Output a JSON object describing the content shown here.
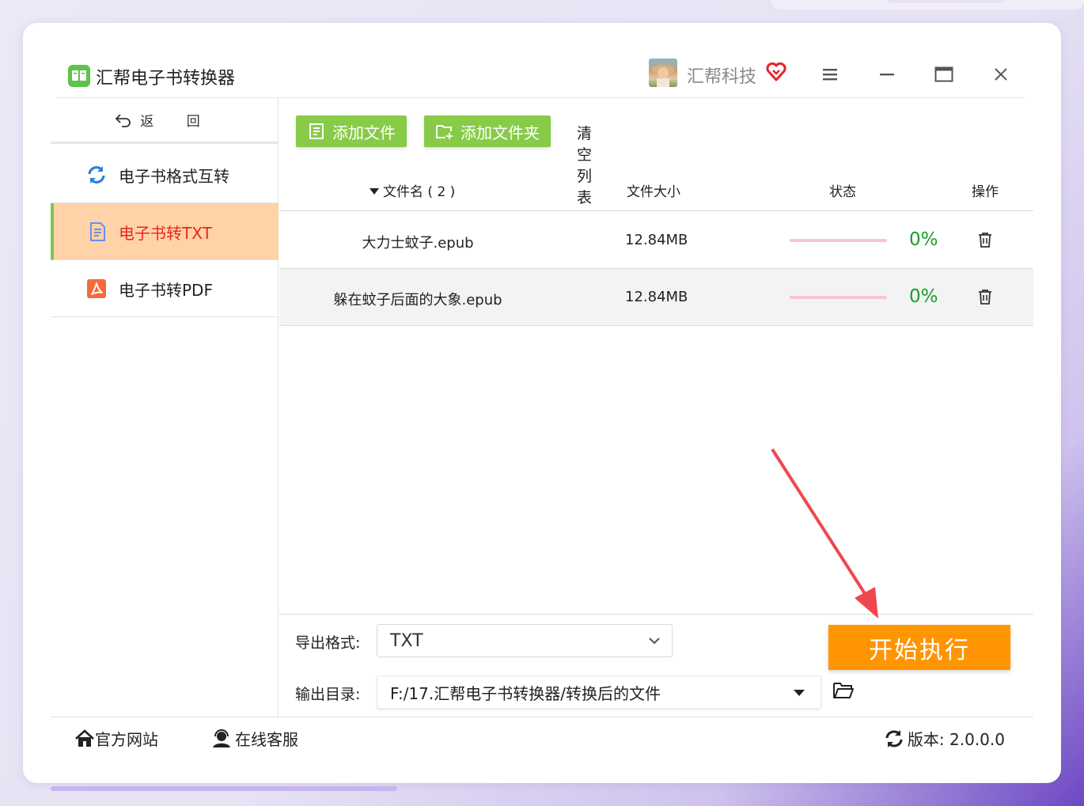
{
  "titlebar": {
    "app_title": "汇帮电子书转换器",
    "username": "汇帮科技",
    "icons": [
      "book-icon",
      "vip-heart-icon",
      "menu-icon",
      "minimize-icon",
      "maximize-icon",
      "close-icon"
    ]
  },
  "sidebar": {
    "back_label": "返 回",
    "items": [
      {
        "label": "电子书格式互转",
        "icon": "refresh-icon",
        "active": false
      },
      {
        "label": "电子书转TXT",
        "icon": "document-icon",
        "active": true
      },
      {
        "label": "电子书转PDF",
        "icon": "pdf-icon",
        "active": false
      }
    ]
  },
  "toolbar": {
    "add_file": "添加文件",
    "add_folder": "添加文件夹",
    "clear_list": "清空列表"
  },
  "table": {
    "headers": {
      "filename": "文件名 ( 2 )",
      "size": "文件大小",
      "status": "状态",
      "action": "操作"
    },
    "rows": [
      {
        "name": "大力士蚊子.epub",
        "size": "12.84MB",
        "progress": 0,
        "progress_text": "0%"
      },
      {
        "name": "躲在蚊子后面的大象.epub",
        "size": "12.84MB",
        "progress": 0,
        "progress_text": "0%"
      }
    ]
  },
  "output": {
    "format_label": "导出格式:",
    "format_value": "TXT",
    "dir_label": "输出目录:",
    "dir_value": "F:/17.汇帮电子书转换器/转换后的文件",
    "start_label": "开始执行"
  },
  "footer": {
    "website": "官方网站",
    "support": "在线客服",
    "version": "版本:  2.0.0.0"
  },
  "colors": {
    "accent_green": "#88cb49",
    "active_bg": "#ffd2a7",
    "active_text": "#e8271e",
    "start_orange": "#ff9500",
    "percent_green": "#1a9d2a",
    "arrow_red": "#f0474f"
  }
}
